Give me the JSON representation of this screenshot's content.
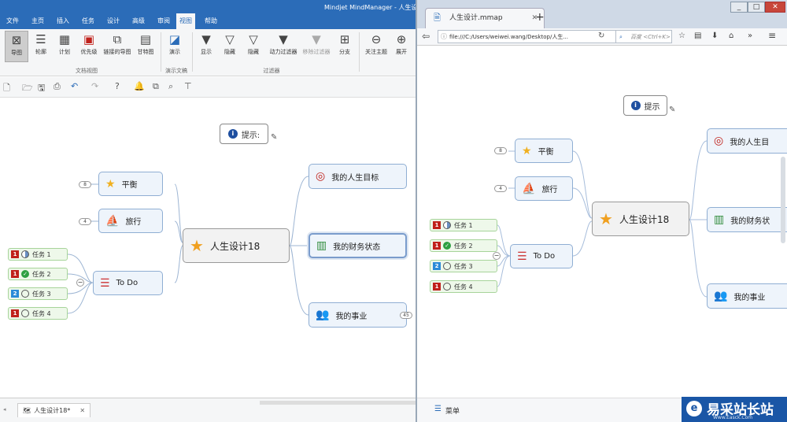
{
  "app": {
    "title": "Mindjet MindManager - 人生设计",
    "menus": [
      "文件",
      "主页",
      "插入",
      "任务",
      "设计",
      "高级",
      "审阅",
      "视图",
      "帮助"
    ],
    "active_menu": "视图",
    "ribbon_buttons": [
      "导图",
      "轮廓",
      "计划",
      "优先级",
      "链接的导图",
      "甘特图",
      "演示",
      "显示",
      "隐藏",
      "隐藏",
      "动力过滤器",
      "移除过滤器",
      "分支",
      "关注主题",
      "展开"
    ],
    "ribbon_groups": [
      "文档视图",
      "演示文稿",
      "过滤器"
    ],
    "doc_tab": "人生设计18*",
    "tab_close": "✕"
  },
  "map": {
    "center": "人生设计18",
    "tip": "提示:",
    "left": [
      {
        "label": "平衡",
        "count": "8"
      },
      {
        "label": "旅行",
        "count": "4"
      },
      {
        "label": "To Do"
      }
    ],
    "right": [
      {
        "label": "我的人生目标"
      },
      {
        "label": "我的财务状态"
      },
      {
        "label": "我的事业",
        "count": "45"
      }
    ],
    "tasks": [
      {
        "pri": "1",
        "status": "half",
        "label": "任务 1"
      },
      {
        "pri": "1",
        "status": "done",
        "label": "任务 2"
      },
      {
        "pri": "2",
        "status": "empty",
        "label": "任务 3"
      },
      {
        "pri": "1",
        "status": "empty",
        "label": "任务 4"
      }
    ]
  },
  "browser": {
    "tab_title": "人生设计.mmap",
    "new_tab": "+",
    "url": "file:///C:/Users/weiwei.wang/Desktop/人生...",
    "search_placeholder": "百度 <Ctrl+K>",
    "footer_menu": "菜单",
    "map": {
      "center": "人生设计18",
      "tip": "提示",
      "left": [
        {
          "label": "平衡",
          "count": "8"
        },
        {
          "label": "旅行",
          "count": "4"
        },
        {
          "label": "To Do"
        }
      ],
      "right": [
        {
          "label": "我的人生目"
        },
        {
          "label": "我的财务状"
        },
        {
          "label": "我的事业"
        }
      ],
      "tasks": [
        {
          "pri": "1",
          "status": "half",
          "label": "任务 1"
        },
        {
          "pri": "1",
          "status": "done",
          "label": "任务 2"
        },
        {
          "pri": "2",
          "status": "empty",
          "label": "任务 3"
        },
        {
          "pri": "1",
          "status": "empty",
          "label": "任务 4"
        }
      ]
    }
  },
  "watermark": {
    "text": "易采站长站",
    "sub": "Www.Easck.Com"
  }
}
